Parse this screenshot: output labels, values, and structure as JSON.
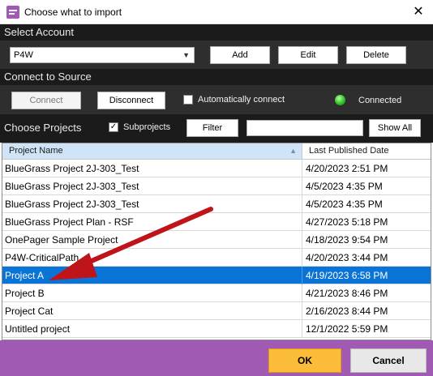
{
  "window": {
    "title": "Choose what to import",
    "close": "✕"
  },
  "account": {
    "heading": "Select Account",
    "selected": "P4W",
    "add_label": "Add",
    "edit_label": "Edit",
    "delete_label": "Delete"
  },
  "source": {
    "heading": "Connect to Source",
    "connect_label": "Connect",
    "disconnect_label": "Disconnect",
    "auto_connect_label": "Automatically connect",
    "auto_connect_checked": false,
    "status": "Connected",
    "status_color": "#2fc12a"
  },
  "projects": {
    "heading": "Choose Projects",
    "subprojects_label": "Subprojects",
    "subprojects_checked": true,
    "filter_label": "Filter",
    "filter_value": "",
    "show_all_label": "Show All"
  },
  "table": {
    "columns": [
      "Project Name",
      "Last Published Date"
    ],
    "rows": [
      {
        "name": "BlueGrass Project 2J-303_Test",
        "date": "4/20/2023 2:51 PM"
      },
      {
        "name": "BlueGrass Project 2J-303_Test",
        "date": "4/5/2023 4:35 PM"
      },
      {
        "name": "BlueGrass Project 2J-303_Test",
        "date": "4/5/2023 4:35 PM"
      },
      {
        "name": "BlueGrass Project Plan - RSF",
        "date": "4/27/2023 5:18 PM"
      },
      {
        "name": "OnePager Sample Project",
        "date": "4/18/2023 9:54 PM"
      },
      {
        "name": "P4W-CriticalPath",
        "date": "4/20/2023 3:44 PM"
      },
      {
        "name": "Project A",
        "date": "4/19/2023 6:58 PM"
      },
      {
        "name": "Project B",
        "date": "4/21/2023 8:46 PM"
      },
      {
        "name": "Project Cat",
        "date": "2/16/2023 8:44 PM"
      },
      {
        "name": "Untitled project",
        "date": "12/1/2022 5:59 PM"
      }
    ],
    "selected_index": 6
  },
  "footer": {
    "ok_label": "OK",
    "cancel_label": "Cancel"
  },
  "colors": {
    "footer": "#a05ab4",
    "selection": "#0a74d6",
    "ok": "#fbbc3a",
    "annotation_arrow": "#c0141b"
  }
}
